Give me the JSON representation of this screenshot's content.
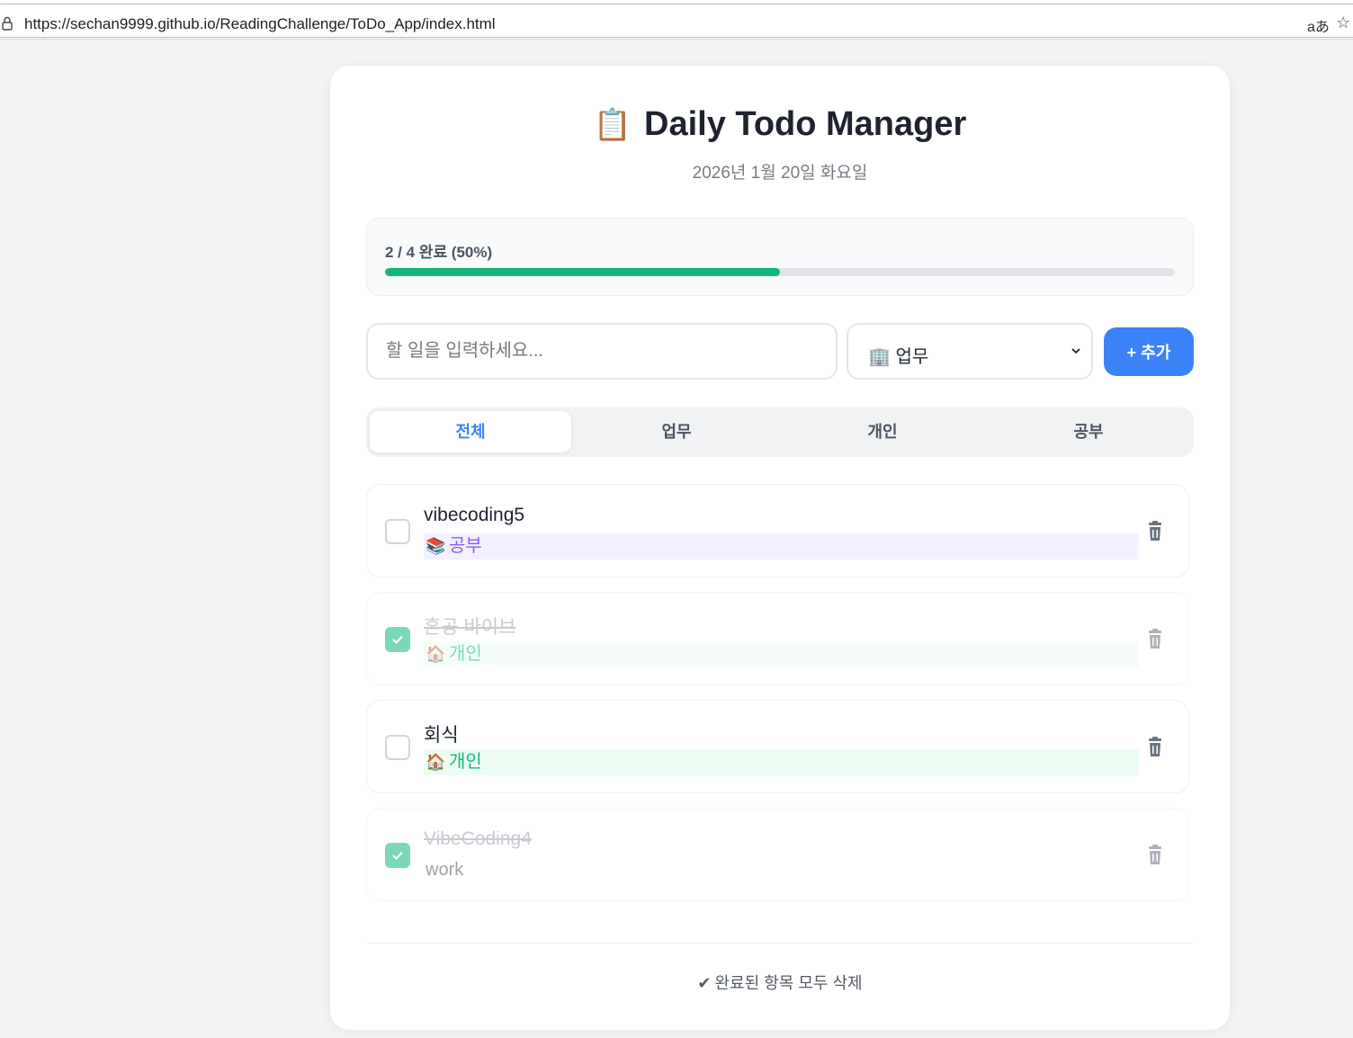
{
  "browser": {
    "url": "https://sechan9999.github.io/ReadingChallenge/ToDo_App/index.html",
    "translate_glyph": "aあ",
    "star_glyph": "☆"
  },
  "app": {
    "title_icon": "📋",
    "title": "Daily Todo Manager",
    "date": "2026년 1월 20일 화요일"
  },
  "progress": {
    "label": "2 / 4 완료 (50%)",
    "completed": 2,
    "total": 4,
    "percent": 50,
    "color": "#12b77c"
  },
  "input": {
    "placeholder": "할 일을 입력하세요..."
  },
  "category_select": {
    "selected_icon": "🏢",
    "selected_label": "업무"
  },
  "add_button": {
    "label": "+ 추가",
    "color": "#3b82f6"
  },
  "tabs": [
    {
      "label": "전체",
      "active": true
    },
    {
      "label": "업무",
      "active": false
    },
    {
      "label": "개인",
      "active": false
    },
    {
      "label": "공부",
      "active": false
    }
  ],
  "todos": [
    {
      "text": "vibecoding5",
      "done": false,
      "tag_icon": "📚",
      "tag_label": "공부",
      "tag_type": "study"
    },
    {
      "text": "혼공 바이브",
      "done": true,
      "tag_icon": "🏠",
      "tag_label": "개인",
      "tag_type": "personal"
    },
    {
      "text": "회식",
      "done": false,
      "tag_icon": "🏠",
      "tag_label": "개인",
      "tag_type": "personal"
    },
    {
      "text": "VibeCoding4",
      "done": true,
      "tag_icon": "",
      "tag_label": "work",
      "tag_type": "plain"
    }
  ],
  "clear_button": {
    "icon": "✔",
    "label": "완료된 항목 모두 삭제"
  }
}
